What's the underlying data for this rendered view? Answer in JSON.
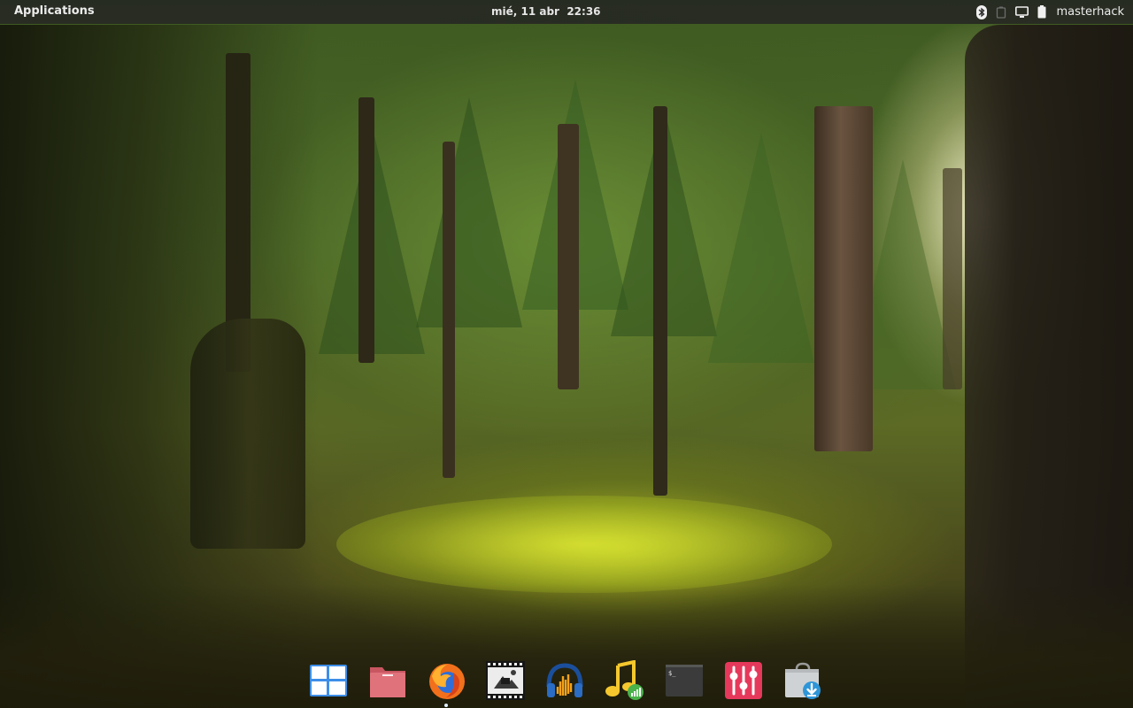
{
  "panel": {
    "applications_label": "Applications",
    "clock": "mié, 11 abr  22:36",
    "indicators": [
      {
        "icon": "bluetooth-icon"
      },
      {
        "icon": "network-icon"
      },
      {
        "icon": "display-icon"
      },
      {
        "icon": "battery-icon"
      }
    ],
    "user_name": "masterhack"
  },
  "dock": {
    "items": [
      {
        "icon": "multitasking-view-icon"
      },
      {
        "icon": "files-icon"
      },
      {
        "icon": "firefox-icon",
        "running": true
      },
      {
        "icon": "video-editor-icon"
      },
      {
        "icon": "audio-headphones-icon"
      },
      {
        "icon": "music-icon"
      },
      {
        "icon": "terminal-icon",
        "glyph": "$_"
      },
      {
        "icon": "equalizer-icon"
      },
      {
        "icon": "appcenter-download-icon"
      }
    ]
  },
  "colors": {
    "panel_bg": "#242522",
    "firefox_orange": "#f2701c",
    "firefox_blue": "#2f6ed8",
    "files_pink": "#e0727b",
    "equalizer_red": "#e6385a",
    "terminal_dark": "#3a3b3a",
    "running_indicator": "#dcefff"
  }
}
